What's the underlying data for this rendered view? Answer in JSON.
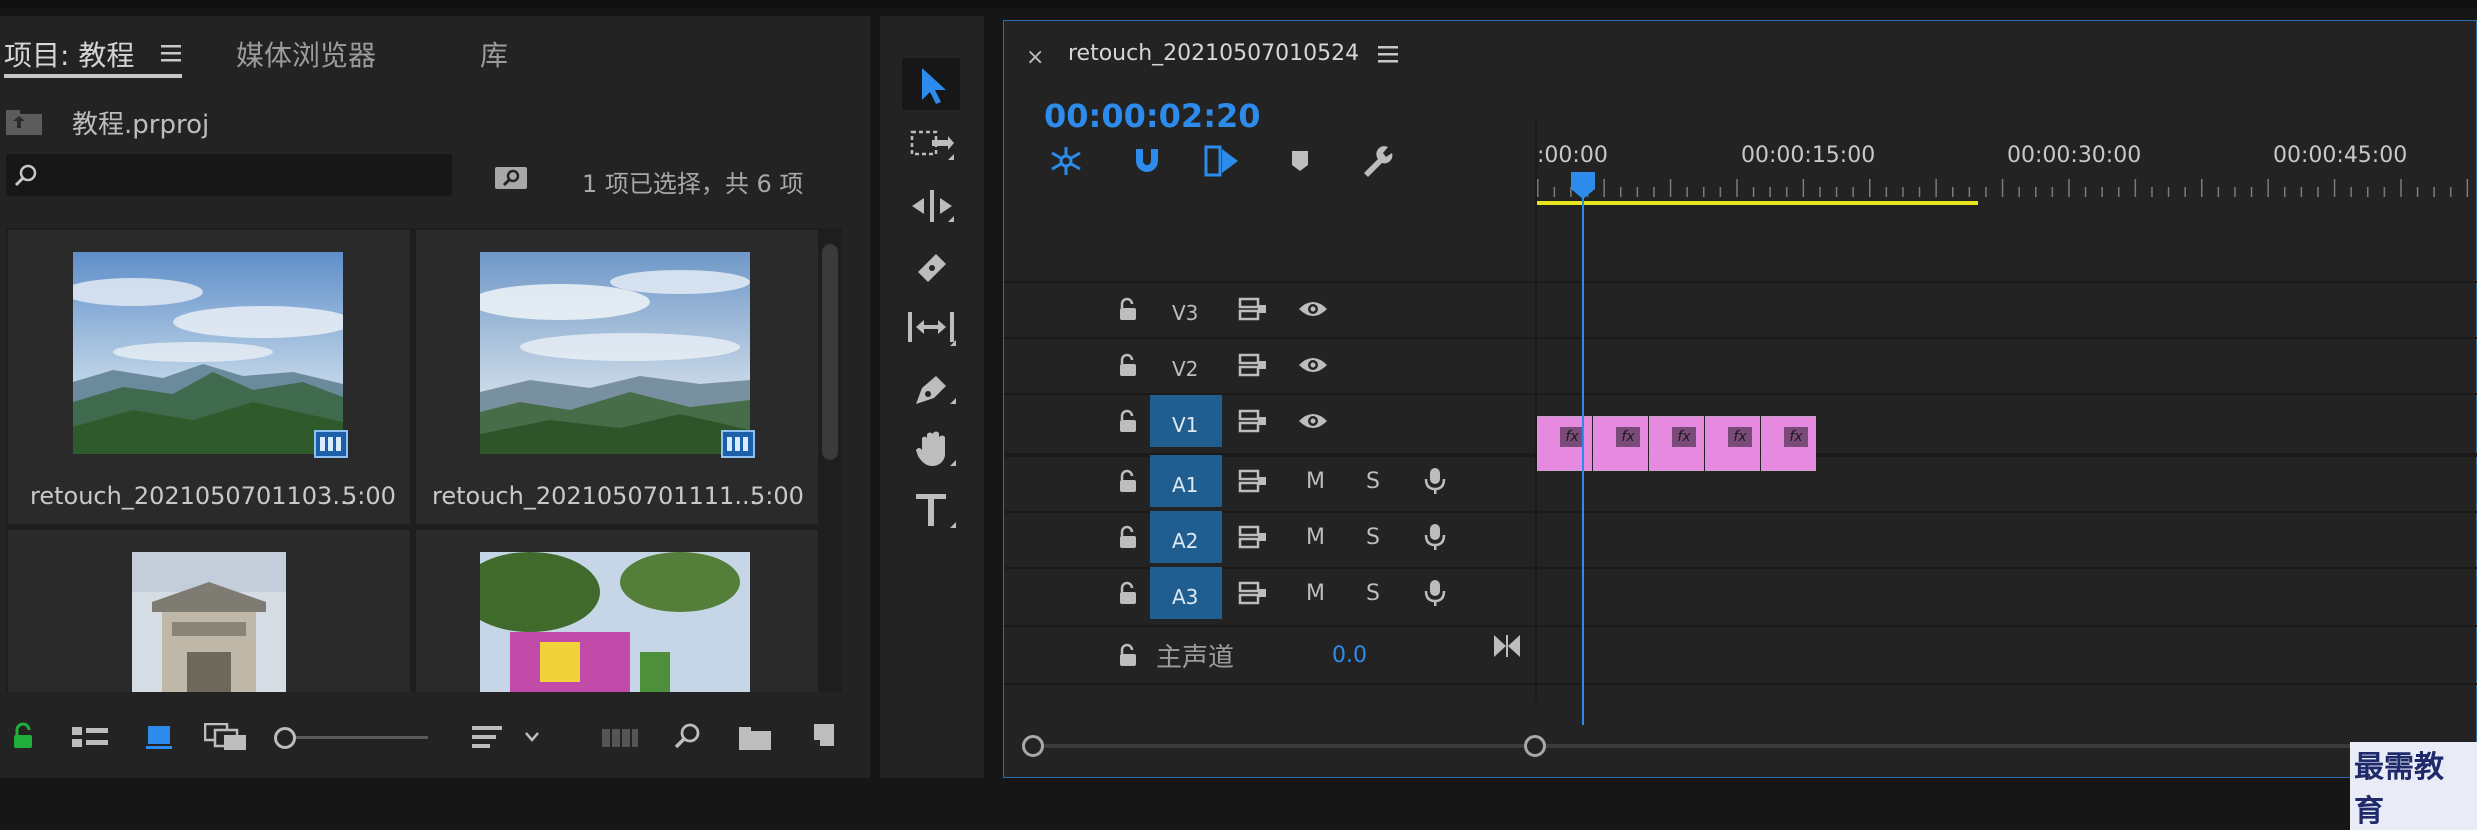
{
  "project_panel": {
    "tabs": [
      "项目: 教程",
      "媒体浏览器",
      "库"
    ],
    "tab_menu_icon": "hamburger-icon",
    "file_name": "教程.prproj",
    "search_placeholder": "",
    "selection_status": "1 项已选择，共 6 项",
    "items": [
      {
        "name": "retouch_2021050701103...",
        "duration": "5:00"
      },
      {
        "name": "retouch_2021050701111...",
        "duration": "5:00"
      },
      {
        "name": "",
        "duration": ""
      },
      {
        "name": "",
        "duration": ""
      }
    ]
  },
  "tools": [
    "selection-tool",
    "track-select-tool",
    "ripple-edit-tool",
    "razor-tool",
    "slip-tool",
    "pen-tool",
    "hand-tool",
    "type-tool"
  ],
  "timeline": {
    "sequence_name": "retouch_20210507010524",
    "timecode": "00:00:02:20",
    "ruler_labels": [
      ":00:00",
      "00:00:15:00",
      "00:00:30:00",
      "00:00:45:00"
    ],
    "video_tracks": [
      "V3",
      "V2",
      "V1"
    ],
    "audio_tracks": [
      "A1",
      "A2",
      "A3"
    ],
    "mute_label": "M",
    "solo_label": "S",
    "master_label": "主声道",
    "master_value": "0.0",
    "clip_label": "fx",
    "clip_count": 5
  },
  "watermark": "最需教育",
  "colors": {
    "accent_blue": "#2d8ceb",
    "clip_pink": "#e68ae0",
    "track_target_blue": "#1f5e8e",
    "work_area_yellow": "#e7e51d"
  }
}
